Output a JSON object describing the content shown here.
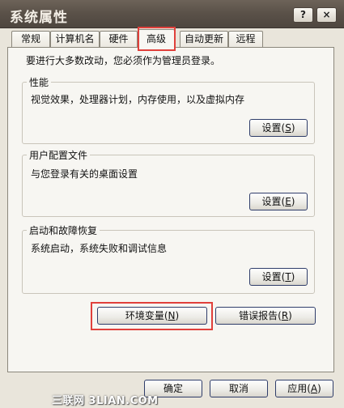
{
  "window": {
    "title": "系统属性",
    "help_label": "?",
    "close_label": "×"
  },
  "tabs": [
    {
      "label": "常规"
    },
    {
      "label": "计算机名"
    },
    {
      "label": "硬件"
    },
    {
      "label": "高级"
    },
    {
      "label": "自动更新"
    },
    {
      "label": "远程"
    }
  ],
  "active_tab": "高级",
  "advanced": {
    "admin_notice": "要进行大多数改动，您必须作为管理员登录。",
    "performance": {
      "title": "性能",
      "description": "视觉效果，处理器计划，内存使用，以及虚拟内存",
      "button": {
        "label": "设置",
        "accel": "S"
      }
    },
    "user_profiles": {
      "title": "用户配置文件",
      "description": "与您登录有关的桌面设置",
      "button": {
        "label": "设置",
        "accel": "E"
      }
    },
    "startup_recovery": {
      "title": "启动和故障恢复",
      "description": "系统启动，系统失败和调试信息",
      "button": {
        "label": "设置",
        "accel": "T"
      }
    },
    "env_vars_button": {
      "label": "环境变量",
      "accel": "N"
    },
    "error_report_button": {
      "label": "错误报告",
      "accel": "R"
    }
  },
  "footer": {
    "ok_label": "确定",
    "cancel_label": "取消",
    "apply": {
      "label": "应用",
      "accel": "A"
    }
  },
  "watermark": "三联网 3LIAN.COM",
  "colors": {
    "titlebar": "#5b5249",
    "dialog_bg": "#e9e5db",
    "panel_bg": "#f7f6f2",
    "highlight": "#e0403b"
  }
}
